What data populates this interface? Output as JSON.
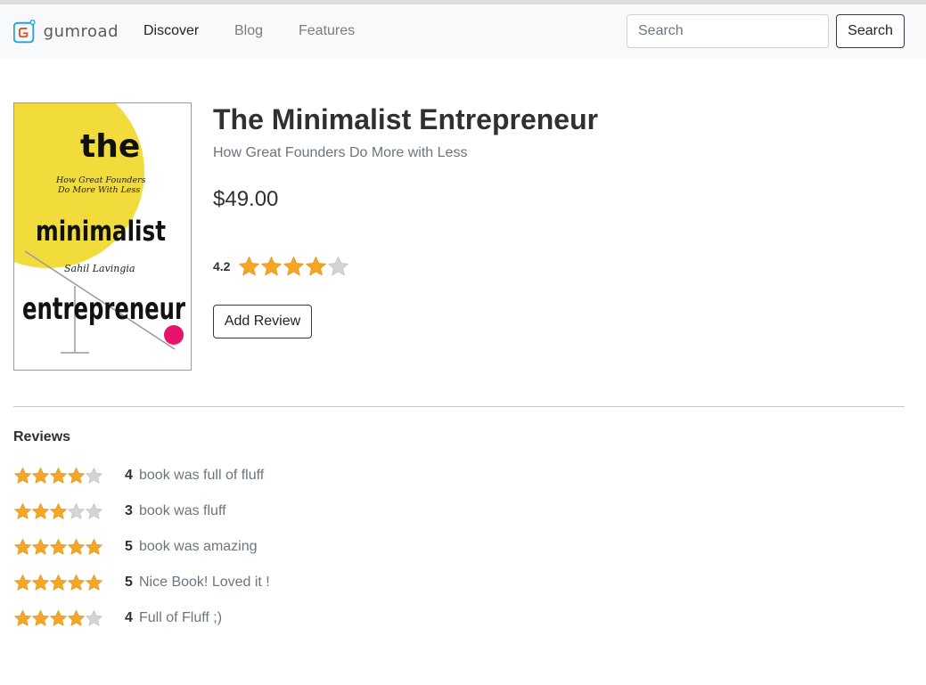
{
  "colors": {
    "star_fill": "#f5a623",
    "star_empty": "#d4d4d4",
    "navbar_bg": "#f8f9fa",
    "text_muted": "#6c757d"
  },
  "navbar": {
    "brand": "gumroad",
    "links": [
      {
        "label": "Discover",
        "active": true
      },
      {
        "label": "Blog",
        "active": false
      },
      {
        "label": "Features",
        "active": false
      }
    ],
    "search_placeholder": "Search",
    "search_button": "Search"
  },
  "product": {
    "cover": {
      "line1": "the",
      "tagline1": "How Great Founders",
      "tagline2": "Do More With Less",
      "line2": "minimalist",
      "author": "Sahil Lavingia",
      "line3": "entrepreneur"
    },
    "title": "The Minimalist Entrepreneur",
    "subtitle": "How Great Founders Do More with Less",
    "price": "$49.00",
    "rating": "4.2",
    "rating_value": 4.2,
    "add_review_label": "Add Review"
  },
  "reviews": {
    "heading": "Reviews",
    "items": [
      {
        "stars": 4,
        "rating": "4",
        "text": "book was full of fluff"
      },
      {
        "stars": 3,
        "rating": "3",
        "text": "book was fluff"
      },
      {
        "stars": 5,
        "rating": "5",
        "text": "book was amazing"
      },
      {
        "stars": 5,
        "rating": "5",
        "text": "Nice Book! Loved it !"
      },
      {
        "stars": 4,
        "rating": "4",
        "text": "Full of Fluff ;)"
      }
    ]
  }
}
